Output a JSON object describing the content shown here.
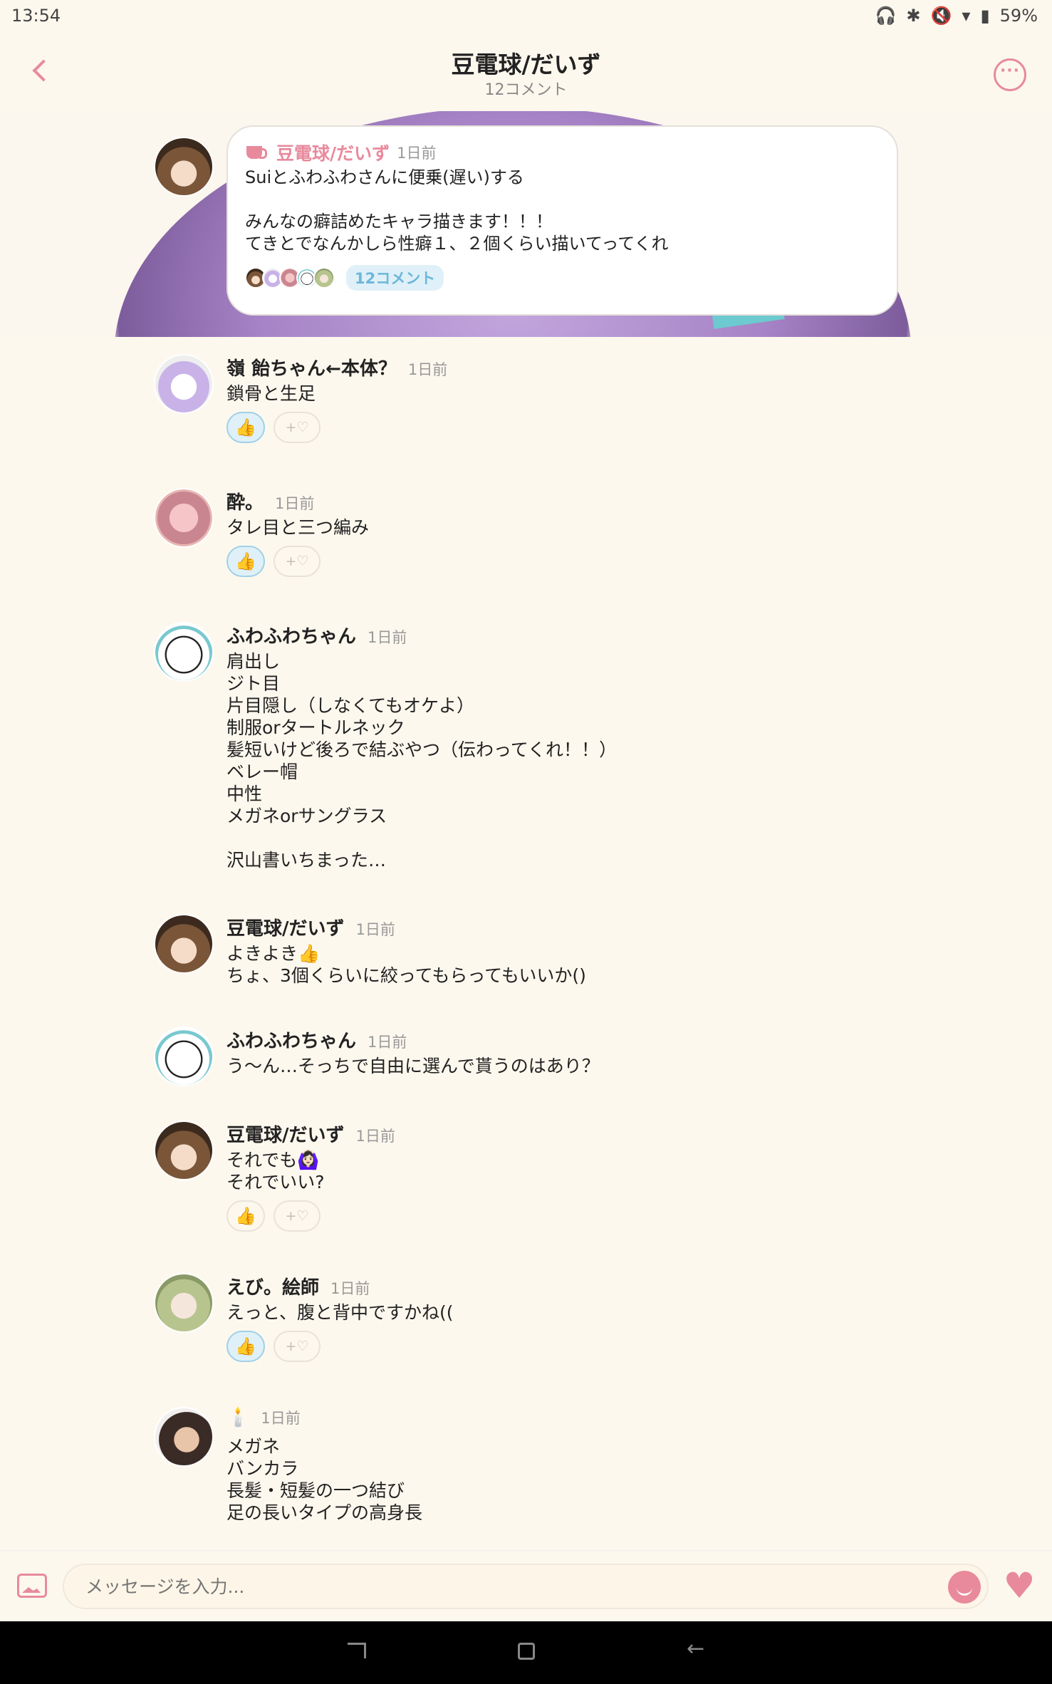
{
  "status_bar": {
    "time": "13:54",
    "battery": "59%",
    "icons": [
      "headphones-icon",
      "bluetooth-icon",
      "mute-icon",
      "wifi-icon",
      "battery-icon"
    ]
  },
  "header": {
    "title": "豆電球/だいず",
    "subtitle": "12コメント"
  },
  "original_post": {
    "author": "豆電球/だいず",
    "time": "1日前",
    "lines": [
      "Suiとふわふわさんに便乗(遅い)する",
      "",
      "みんなの癖詰めたキャラ描きます！！！",
      "てきとでなんかしら性癖１、２個くらい描いてってくれ"
    ],
    "comment_count_label": "12コメント"
  },
  "comments": [
    {
      "author": "嶺 飴ちゃん←本体？",
      "time": "1日前",
      "lines": [
        "鎖骨と生足"
      ],
      "like": "👍",
      "add_react": "+♡",
      "liked": true
    },
    {
      "author": "酔。",
      "time": "1日前",
      "lines": [
        "タレ目と三つ編み"
      ],
      "like": "👍",
      "add_react": "+♡",
      "liked": true
    },
    {
      "author": "ふわふわちゃん",
      "time": "1日前",
      "lines": [
        "肩出し",
        "ジト目",
        "片目隠し（しなくてもオケよ）",
        "制服orタートルネック",
        "髪短いけど後ろで結ぶやつ（伝わってくれ！！）",
        "ベレー帽",
        "中性",
        "メガネorサングラス",
        "",
        "沢山書いちまった…"
      ]
    },
    {
      "author": "豆電球/だいず",
      "time": "1日前",
      "lines": [
        "よきよき👍",
        "ちょ、3個くらいに絞ってもらってもいいか()"
      ]
    },
    {
      "author": "ふわふわちゃん",
      "time": "1日前",
      "lines": [
        "う〜ん…そっちで自由に選んで貰うのはあり？"
      ]
    },
    {
      "author": "豆電球/だいず",
      "time": "1日前",
      "lines": [
        "それでも🙆🏻‍♀️",
        "それでいい?"
      ],
      "like": "👍",
      "add_react": "+♡",
      "liked": false
    },
    {
      "author": "えび。絵師",
      "time": "1日前",
      "lines": [
        "えっと、腹と背中ですかね(("
      ],
      "like": "👍",
      "add_react": "+♡",
      "liked": true
    },
    {
      "author": "🕯️",
      "time": "1日前",
      "lines": [
        "メガネ",
        "バンカラ",
        "長髪・短髪の一つ結び",
        "足の長いタイプの高身長"
      ]
    }
  ],
  "input": {
    "placeholder": "メッセージを入力..."
  },
  "colors": {
    "accent": "#e88a9c",
    "background": "#fdf8ee",
    "pill": "#dff0f8"
  }
}
